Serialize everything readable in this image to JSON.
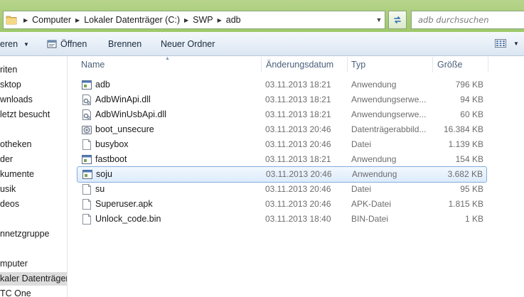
{
  "address": {
    "crumbs": [
      "Computer",
      "Lokaler Datenträger (C:)",
      "SWP",
      "adb"
    ],
    "search_placeholder": "adb durchsuchen"
  },
  "toolbar": {
    "organize_label": "eren",
    "open_label": "Öffnen",
    "burn_label": "Brennen",
    "new_folder_label": "Neuer Ordner"
  },
  "nav": {
    "items": [
      "riten",
      "sktop",
      "wnloads",
      "letzt besucht",
      "otheken",
      "der",
      "kumente",
      "usik",
      "deos",
      "nnetzgruppe",
      "mputer",
      "kaler Datenträger",
      "TC One"
    ]
  },
  "columns": {
    "name": "Name",
    "date": "Änderungsdatum",
    "type": "Typ",
    "size": "Größe"
  },
  "files": [
    {
      "name": "adb",
      "date": "03.11.2013 18:21",
      "type": "Anwendung",
      "size": "796 KB",
      "icon": "app-icon"
    },
    {
      "name": "AdbWinApi.dll",
      "date": "03.11.2013 18:21",
      "type": "Anwendungserwe...",
      "size": "94 KB",
      "icon": "dll-icon"
    },
    {
      "name": "AdbWinUsbApi.dll",
      "date": "03.11.2013 18:21",
      "type": "Anwendungserwe...",
      "size": "60 KB",
      "icon": "dll-icon"
    },
    {
      "name": "boot_unsecure",
      "date": "03.11.2013 20:46",
      "type": "Datenträgerabbild...",
      "size": "16.384 KB",
      "icon": "disc-image-icon"
    },
    {
      "name": "busybox",
      "date": "03.11.2013 20:46",
      "type": "Datei",
      "size": "1.139 KB",
      "icon": "file-icon"
    },
    {
      "name": "fastboot",
      "date": "03.11.2013 18:21",
      "type": "Anwendung",
      "size": "154 KB",
      "icon": "app-icon"
    },
    {
      "name": "soju",
      "date": "03.11.2013 20:46",
      "type": "Anwendung",
      "size": "3.682 KB",
      "icon": "app-icon"
    },
    {
      "name": "su",
      "date": "03.11.2013 20:46",
      "type": "Datei",
      "size": "95 KB",
      "icon": "file-icon"
    },
    {
      "name": "Superuser.apk",
      "date": "03.11.2013 20:46",
      "type": "APK-Datei",
      "size": "1.815 KB",
      "icon": "file-icon"
    },
    {
      "name": "Unlock_code.bin",
      "date": "03.11.2013 18:40",
      "type": "BIN-Datei",
      "size": "1 KB",
      "icon": "file-icon"
    }
  ],
  "selected_file": "soju",
  "colors": {
    "address_bar_green": "#a9cd79",
    "selection_border": "#84acdd",
    "header_text": "#4c607a"
  }
}
